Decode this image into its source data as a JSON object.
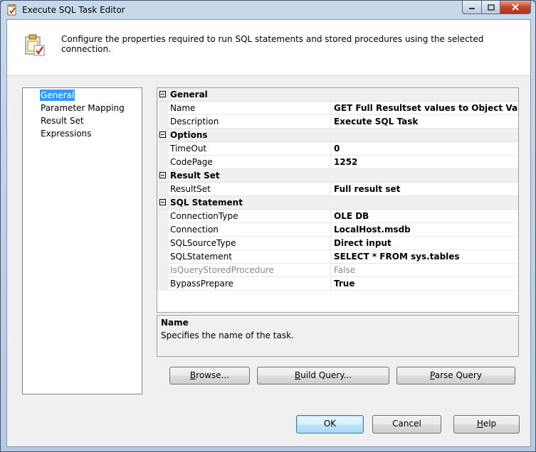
{
  "window": {
    "title": "Execute SQL Task Editor"
  },
  "header": {
    "text": "Configure the properties required to run SQL statements and stored procedures using the selected connection."
  },
  "nav": {
    "items": [
      {
        "label": "General",
        "selected": true
      },
      {
        "label": "Parameter Mapping",
        "selected": false
      },
      {
        "label": "Result Set",
        "selected": false
      },
      {
        "label": "Expressions",
        "selected": false
      }
    ]
  },
  "properties": {
    "categories": [
      {
        "label": "General",
        "rows": [
          {
            "name": "Name",
            "value": "GET Full Resultset values to Object Variable"
          },
          {
            "name": "Description",
            "value": "Execute SQL Task"
          }
        ]
      },
      {
        "label": "Options",
        "rows": [
          {
            "name": "TimeOut",
            "value": "0"
          },
          {
            "name": "CodePage",
            "value": "1252"
          }
        ]
      },
      {
        "label": "Result Set",
        "rows": [
          {
            "name": "ResultSet",
            "value": "Full result set"
          }
        ]
      },
      {
        "label": "SQL Statement",
        "rows": [
          {
            "name": "ConnectionType",
            "value": "OLE DB"
          },
          {
            "name": "Connection",
            "value": "LocalHost.msdb"
          },
          {
            "name": "SQLSourceType",
            "value": "Direct input"
          },
          {
            "name": "SQLStatement",
            "value": "SELECT * FROM sys.tables"
          },
          {
            "name": "IsQueryStoredProcedure",
            "value": "False",
            "disabled": true
          },
          {
            "name": "BypassPrepare",
            "value": "True"
          }
        ]
      }
    ]
  },
  "description": {
    "title": "Name",
    "text": "Specifies the name of the task."
  },
  "buttons": {
    "browse_rest": "rowse...",
    "browse_key": "B",
    "build_key": "B",
    "build_rest": "uild Query...",
    "parse_key": "P",
    "parse_rest": "arse Query",
    "ok": "OK",
    "cancel": "Cancel",
    "help_key": "H",
    "help_rest": "elp"
  },
  "colors": {
    "selection": "#3399ff",
    "client_bg": "#f0f0f0",
    "frame": "#b6c9e0"
  }
}
